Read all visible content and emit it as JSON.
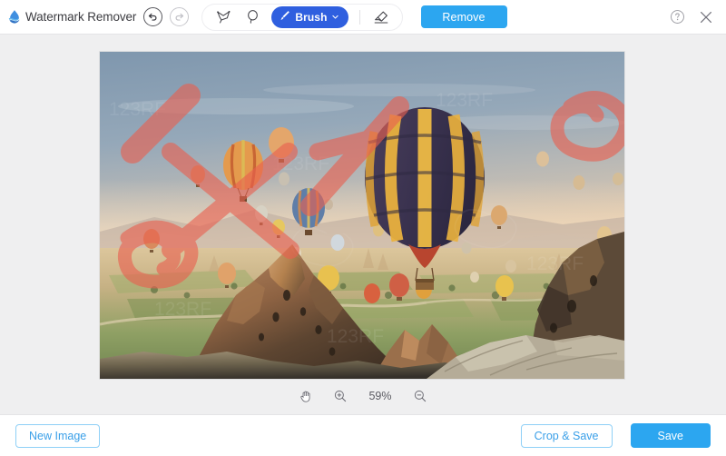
{
  "app": {
    "title": "Watermark Remover",
    "logo_icon": "water-drop-logo",
    "accent_blue": "#2ca6f0",
    "brush_blue": "#2f5fdf",
    "canvas_bg": "#efeff0"
  },
  "toolbar": {
    "undo": {
      "label": "Undo",
      "icon": "undo-arrow-icon",
      "enabled": true
    },
    "redo": {
      "label": "Redo",
      "icon": "redo-arrow-icon",
      "enabled": false
    },
    "tools": [
      {
        "id": "polygon",
        "label": "Polygonal Lasso",
        "icon": "polygon-lasso-icon",
        "active": false
      },
      {
        "id": "lasso",
        "label": "Lasso",
        "icon": "lasso-icon",
        "active": false
      },
      {
        "id": "brush",
        "label": "Brush",
        "icon": "brush-icon",
        "active": true,
        "chevron": "chevron-down-icon"
      },
      {
        "id": "eraser",
        "label": "Eraser",
        "icon": "eraser-icon",
        "active": false
      }
    ],
    "remove_label": "Remove",
    "help_icon": "question-circle-icon",
    "close_icon": "close-x-icon"
  },
  "zoombar": {
    "pan_icon": "hand-pan-icon",
    "zoom_in_icon": "zoom-in-icon",
    "zoom_out_icon": "zoom-out-icon",
    "zoom_level": "59%"
  },
  "footer": {
    "new_image_label": "New Image",
    "crop_save_label": "Crop & Save",
    "save_label": "Save"
  },
  "photo": {
    "description": "Cappadocia hot air balloons over rock formations at sunrise",
    "watermark_text": "123RF",
    "mask_color": "#e8604f",
    "mask_opacity": 0.62
  }
}
